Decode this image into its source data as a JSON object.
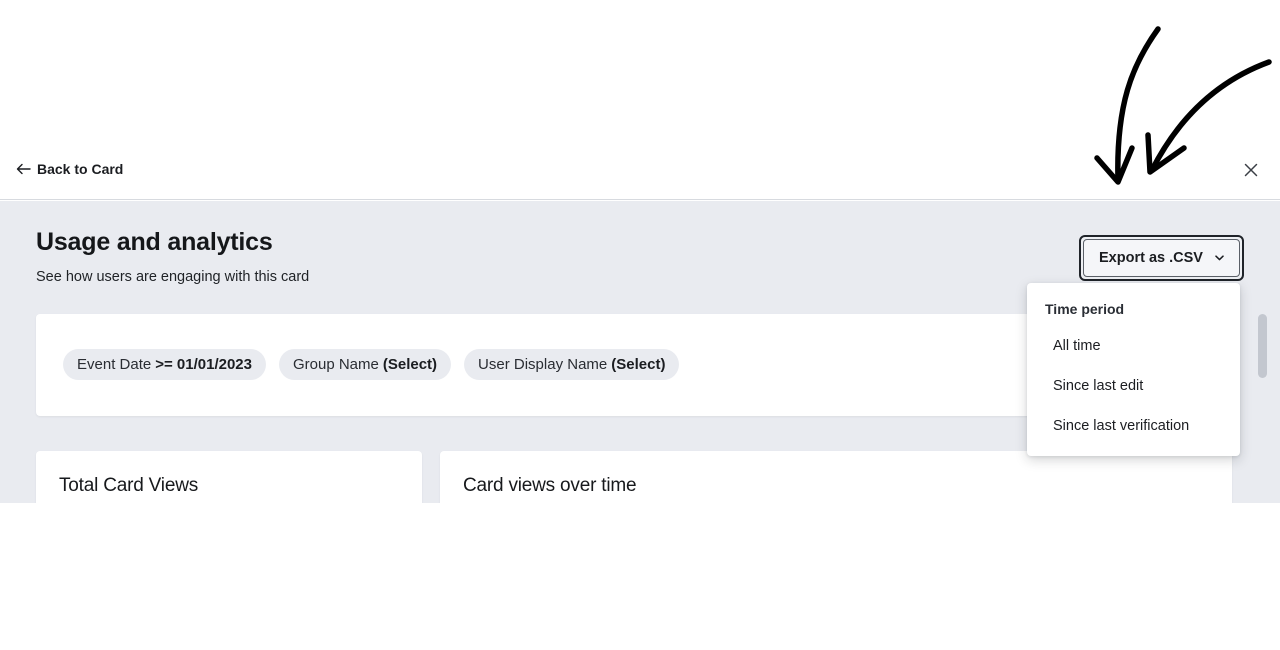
{
  "topbar": {
    "back_label": "Back to Card",
    "back_icon": "arrow-left-icon",
    "close_icon": "close-icon"
  },
  "header": {
    "title": "Usage and analytics",
    "subtitle": "See how users are engaging with this card"
  },
  "export": {
    "label": "Export as .CSV",
    "icon": "chevron-down-icon",
    "menu": {
      "header": "Time period",
      "items": [
        {
          "label": "All time"
        },
        {
          "label": "Since last edit"
        },
        {
          "label": "Since last verification"
        }
      ]
    }
  },
  "filters": [
    {
      "name": "Event Date",
      "value": ">= 01/01/2023"
    },
    {
      "name": "Group Name",
      "value": "(Select)"
    },
    {
      "name": "User Display Name",
      "value": "(Select)"
    }
  ],
  "panels": {
    "total_views_title": "Total Card Views",
    "views_over_time_title": "Card views over time"
  },
  "annotation": {
    "icon": "hand-drawn-arrows-icon"
  },
  "colors": {
    "content_bg": "#e9ebf0",
    "chip_bg": "#e9ebf0",
    "text_primary": "#1b1d21",
    "scroll_thumb": "#c3c7cf"
  }
}
